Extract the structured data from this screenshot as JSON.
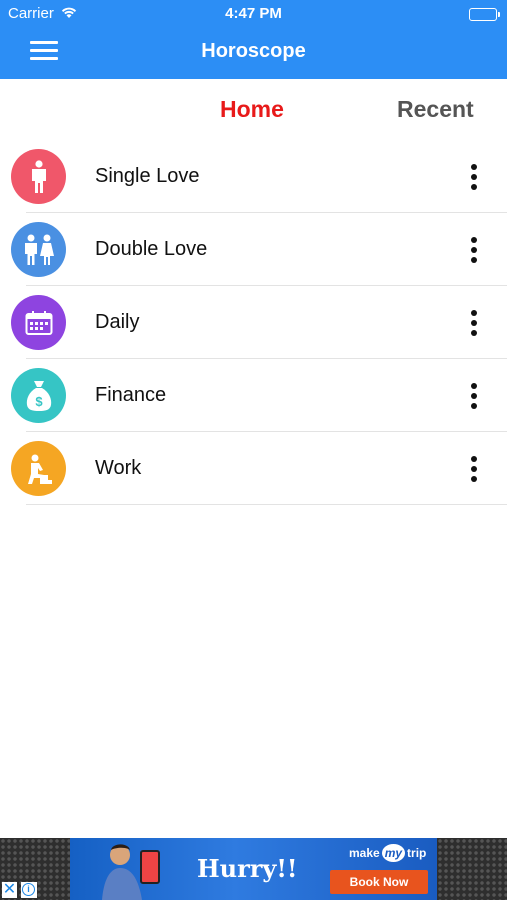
{
  "status_bar": {
    "carrier": "Carrier",
    "time": "4:47 PM"
  },
  "nav": {
    "title": "Horoscope"
  },
  "tabs": [
    {
      "label": "Home",
      "active": true,
      "color": "#e81a1a"
    },
    {
      "label": "Recent",
      "active": false,
      "color": "#555555"
    }
  ],
  "list": [
    {
      "label": "Single Love",
      "icon": "single-person-icon",
      "color": "#f0576a"
    },
    {
      "label": "Double Love",
      "icon": "couple-icon",
      "color": "#4a90e2"
    },
    {
      "label": "Daily",
      "icon": "calendar-icon",
      "color": "#8e44e0"
    },
    {
      "label": "Finance",
      "icon": "money-bag-icon",
      "color": "#36c5c5"
    },
    {
      "label": "Work",
      "icon": "worker-icon",
      "color": "#f5a623"
    }
  ],
  "ad": {
    "headline": "Hurry!!",
    "brand_make": "make",
    "brand_my": "my",
    "brand_trip": "trip",
    "cta": "Book Now",
    "close_symbol": "✕",
    "info_symbol": "i"
  },
  "colors": {
    "nav_bg": "#2c8ef5",
    "accent": "#e81a1a"
  }
}
